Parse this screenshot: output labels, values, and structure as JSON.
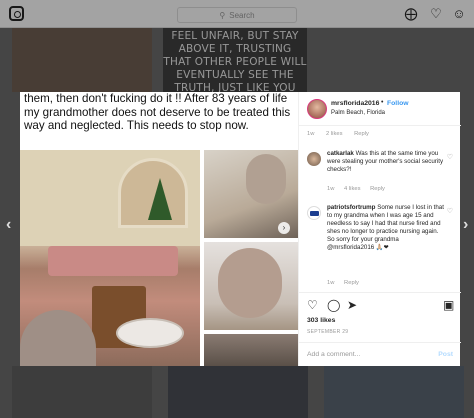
{
  "topbar": {
    "search_placeholder": "Search",
    "icons": [
      "instagram-logo-icon",
      "search-icon",
      "compass-icon",
      "heart-icon",
      "profile-icon"
    ]
  },
  "background": {
    "meme_text": "FEEL UNFAIR, BUT STAY ABOVE IT, TRUSTING THAT OTHER PEOPLE WILL EVENTUALLY SEE THE TRUTH, JUST LIKE YOU DID"
  },
  "post": {
    "text": "them, then don't fucking do it !! After 83 years of life my grandmother does not deserve to be treated this way and neglected. This needs to stop now."
  },
  "panel": {
    "username": "mrsflorida2016",
    "separator": "•",
    "follow_label": "Follow",
    "location": "Palm Beach, Florida",
    "caption_meta": {
      "time": "1w",
      "likes": "2 likes",
      "reply": "Reply"
    },
    "comments": [
      {
        "user": "catkarlak",
        "text": "Was this at the same time you were stealing your mother's social security checks?!",
        "time": "1w",
        "likes": "4 likes",
        "reply": "Reply"
      },
      {
        "user": "patriotsfortrump",
        "text": "Some nurse I lost in that to my grandma when I was age 15 and needless to say I had that nurse fired and shes no longer to practice nursing again. So sorry for your grandma @mrsflorida2016 🙏🏼❤",
        "time": "1w",
        "likes": "",
        "reply": "Reply"
      }
    ],
    "likes_count": "303 likes",
    "date": "SEPTEMBER 29",
    "add_comment_placeholder": "Add a comment...",
    "post_label": "Post"
  },
  "colors": {
    "link": "#3897f0",
    "meta": "#999999",
    "text": "#262626",
    "post_disabled": "#b3dbff"
  }
}
